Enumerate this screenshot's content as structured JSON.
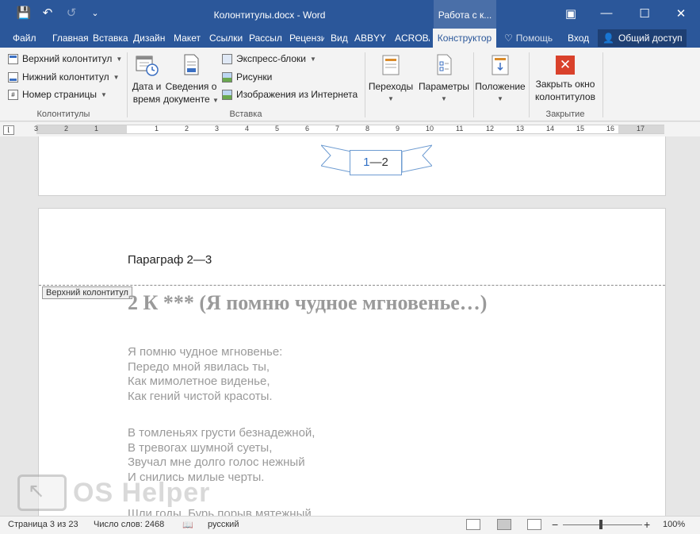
{
  "window": {
    "title": "Колонтитулы.docx - Word",
    "context_tab": "Работа с к...",
    "controls": {
      "restore": "▣",
      "minimize": "—",
      "maximize": "☐",
      "close": "✕"
    }
  },
  "quick_access": {
    "save_icon": "💾",
    "undo_icon": "↶",
    "redo_icon": "↺",
    "customize_icon": "⌄"
  },
  "tabs": [
    {
      "label": "Файл"
    },
    {
      "label": "Главная"
    },
    {
      "label": "Вставка"
    },
    {
      "label": "Дизайн"
    },
    {
      "label": "Макет"
    },
    {
      "label": "Ссылки"
    },
    {
      "label": "Рассыл"
    },
    {
      "label": "Рецензи"
    },
    {
      "label": "Вид"
    },
    {
      "label": "ABBYY F"
    },
    {
      "label": "ACROBA"
    },
    {
      "label": "Конструктор"
    }
  ],
  "tell_me": "Помощь",
  "signin": "Вход",
  "share": "Общий доступ",
  "ribbon": {
    "kolontituly": {
      "header": "Верхний колонтитул",
      "footer": "Нижний колонтитул",
      "page_number": "Номер страницы",
      "group": "Колонтитулы"
    },
    "vstavka": {
      "date_time_1": "Дата и",
      "date_time_2": "время",
      "doc_info_1": "Сведения о",
      "doc_info_2": "документе",
      "quick_parts": "Экспресс-блоки",
      "pictures": "Рисунки",
      "online_pictures": "Изображения из Интернета",
      "group": "Вставка"
    },
    "navigation": {
      "label": "Переходы"
    },
    "parameters": {
      "label": "Параметры"
    },
    "position": {
      "label": "Положение"
    },
    "close": {
      "label_1": "Закрыть окно",
      "label_2": "колонтитулов",
      "group": "Закрытие"
    }
  },
  "ruler": {
    "numbers": [
      "3",
      "2",
      "1",
      "1",
      "2",
      "3",
      "4",
      "5",
      "6",
      "7",
      "8",
      "9",
      "10",
      "11",
      "12",
      "13",
      "14",
      "15",
      "16",
      "17"
    ]
  },
  "document": {
    "footer_page_number_a": "1",
    "footer_page_number_b": "—2",
    "header_text": "Параграф 2—3",
    "header_tag": "Верхний колонтитул",
    "heading": "2  К *** (Я помню чудное мгновенье…)",
    "stanza1": [
      "Я помню чудное мгновенье:",
      "Передо мной явилась ты,",
      "Как мимолетное виденье,",
      "Как гений чистой красоты."
    ],
    "stanza2": [
      "В томленьях грусти безнадежной,",
      "В тревогах шумной суеты,",
      "Звучал мне долго голос нежный",
      "И снились милые черты."
    ],
    "stanza3": [
      "Шли годы. Бурь порыв мятежный"
    ]
  },
  "watermark": "OS Helper",
  "status": {
    "page": "Страница 3 из 23",
    "words": "Число слов: 2468",
    "language": "русский",
    "zoom_minus": "−",
    "zoom_plus": "+",
    "zoom": "100%"
  }
}
